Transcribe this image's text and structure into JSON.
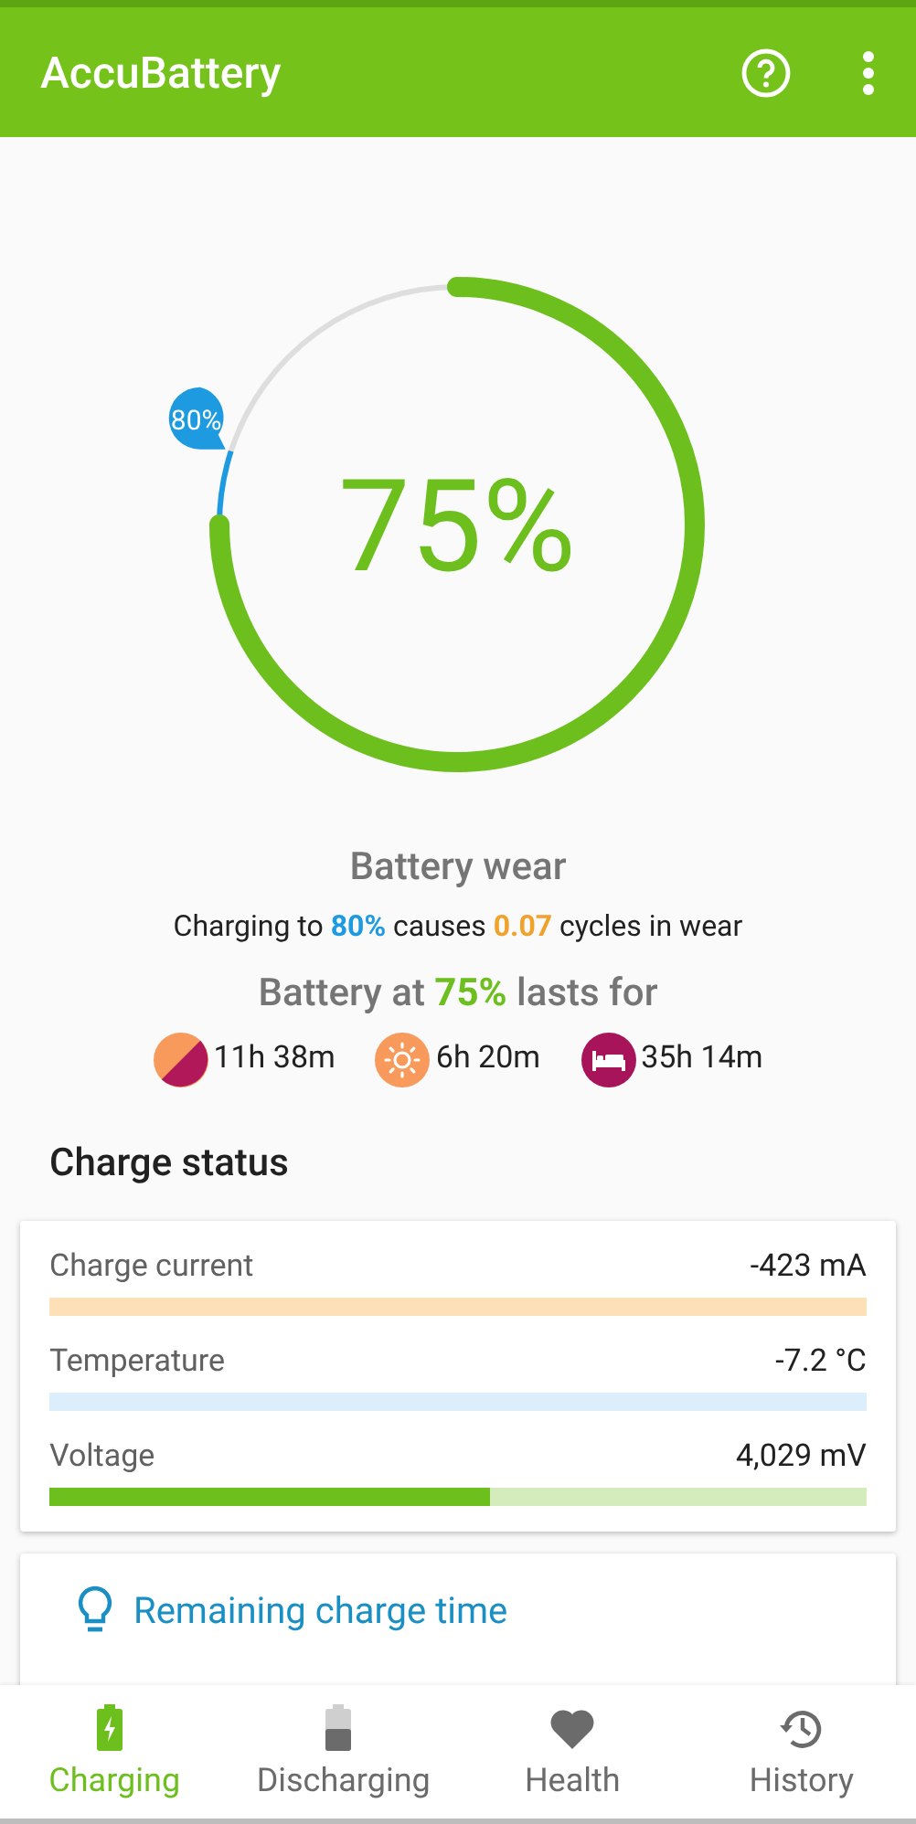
{
  "app_bar": {
    "title": "AccuBattery"
  },
  "gauge": {
    "reading": "75%",
    "charge_limit": {
      "label": "80%"
    }
  },
  "battery_wear": {
    "title": "Battery wear",
    "sentence": [
      {
        "kind": "plain",
        "text": "Charging to "
      },
      {
        "kind": "limit",
        "text": "80%"
      },
      {
        "kind": "plain",
        "text": " causes "
      },
      {
        "kind": "wear",
        "text": "0.07"
      },
      {
        "kind": "plain",
        "text": " cycles in wear"
      }
    ]
  },
  "lasts_for": {
    "heading": [
      {
        "kind": "plain",
        "text": "Battery at "
      },
      {
        "kind": "charge",
        "text": "75%"
      },
      {
        "kind": "plain",
        "text": " lasts for"
      }
    ],
    "times": [
      {
        "kind": "mixed",
        "text": "11h 38m"
      },
      {
        "kind": "screen_on",
        "text": "6h 20m"
      },
      {
        "kind": "sleep",
        "text": "35h 14m"
      }
    ]
  },
  "charge_status": {
    "title": "Charge status",
    "rows": [
      {
        "label": "Charge current",
        "value": "-423 mA",
        "color": "#fde0b8"
      },
      {
        "label": "Temperature",
        "value": "-7.2 °C",
        "color": "#dcedfb"
      },
      {
        "label": "Voltage",
        "value": "4,029 mV",
        "color": "#d4ebbc",
        "level": 0.54
      }
    ]
  },
  "tip_card": {
    "title": "Remaining charge time"
  },
  "bottom_nav": [
    {
      "label": "Charging",
      "kind": "charging",
      "selected": true
    },
    {
      "label": "Discharging",
      "kind": "discharging",
      "selected": false
    },
    {
      "label": "Health",
      "kind": "health",
      "selected": false
    },
    {
      "label": "History",
      "kind": "history",
      "selected": false
    }
  ]
}
